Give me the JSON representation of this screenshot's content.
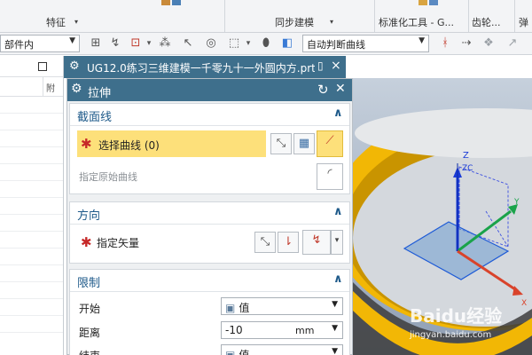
{
  "ribbon": {
    "group1_label": "特征",
    "group2_label": "同步建模",
    "group3_label": "标准化工具 - G...",
    "group4_label": "齿轮...",
    "group5_label": "弹"
  },
  "toolbar": {
    "filter_value": "部件内",
    "curve_rule_value": "自动判断曲线"
  },
  "navigator": {
    "column_header": "附"
  },
  "document_tab": {
    "title": "UG12.0练习三维建模一千零九十一外圆内方.prt"
  },
  "dialog": {
    "title": "拉伸",
    "section_curve": {
      "title": "截面线",
      "select_label": "选择曲线 (0)",
      "specify_original_label": "指定原始曲线"
    },
    "direction": {
      "title": "方向",
      "vector_label": "指定矢量"
    },
    "limits": {
      "title": "限制",
      "start_label": "开始",
      "start_value": "值",
      "distance_label": "距离",
      "distance_value": "-10",
      "distance_unit": "mm",
      "end_label": "结束",
      "end_value": "值"
    }
  },
  "watermark": {
    "text": "Baidu经验",
    "url_text": "jingyan.baidu.com"
  },
  "colors": {
    "title_bar": "#3e6f8c",
    "highlight": "#fde07a",
    "section_title": "#1e5a8a",
    "ring": "#f2b705"
  }
}
